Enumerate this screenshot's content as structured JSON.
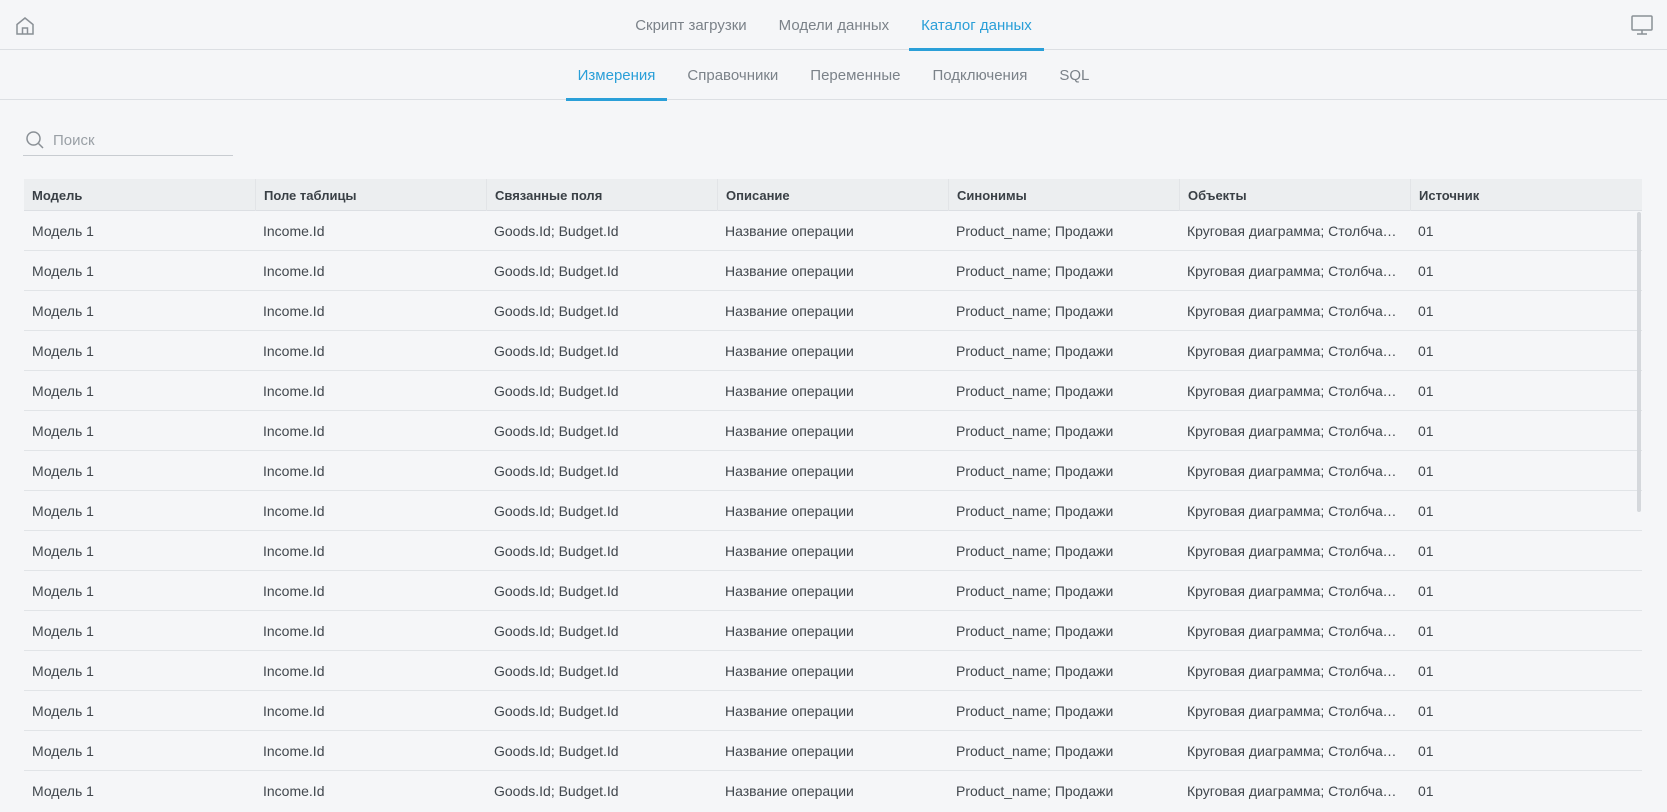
{
  "top_nav": {
    "home_icon": "home-icon",
    "monitor_icon": "monitor-icon",
    "tabs": [
      {
        "label": "Скрипт загрузки",
        "active": false
      },
      {
        "label": "Модели данных",
        "active": false
      },
      {
        "label": "Каталог данных",
        "active": true
      }
    ]
  },
  "sub_nav": {
    "tabs": [
      {
        "label": "Измерения",
        "active": true
      },
      {
        "label": "Справочники",
        "active": false
      },
      {
        "label": "Переменные",
        "active": false
      },
      {
        "label": "Подключения",
        "active": false
      },
      {
        "label": "SQL",
        "active": false
      }
    ]
  },
  "search": {
    "placeholder": "Поиск",
    "value": "",
    "icon": "search-icon"
  },
  "colors": {
    "accent": "#2a9fd8",
    "background": "#f5f6f8",
    "header_bg": "#eceef0"
  },
  "table": {
    "columns": [
      "Модель",
      "Поле таблицы",
      "Связанные поля",
      "Описание",
      "Синонимы",
      "Объекты",
      "Источник"
    ],
    "rows": [
      [
        "Модель 1",
        "Income.Id",
        "Goods.Id; Budget.Id",
        "Название операции",
        "Product_name; Продажи",
        "Круговая диаграмма; Столбчатая диаграмма",
        "01"
      ],
      [
        "Модель 1",
        "Income.Id",
        "Goods.Id; Budget.Id",
        "Название операции",
        "Product_name; Продажи",
        "Круговая диаграмма; Столбчатая диаграмма",
        "01"
      ],
      [
        "Модель 1",
        "Income.Id",
        "Goods.Id; Budget.Id",
        "Название операции",
        "Product_name; Продажи",
        "Круговая диаграмма; Столбчатая диаграмма",
        "01"
      ],
      [
        "Модель 1",
        "Income.Id",
        "Goods.Id; Budget.Id",
        "Название операции",
        "Product_name; Продажи",
        "Круговая диаграмма; Столбчатая диаграмма",
        "01"
      ],
      [
        "Модель 1",
        "Income.Id",
        "Goods.Id; Budget.Id",
        "Название операции",
        "Product_name; Продажи",
        "Круговая диаграмма; Столбчатая диаграмма",
        "01"
      ],
      [
        "Модель 1",
        "Income.Id",
        "Goods.Id; Budget.Id",
        "Название операции",
        "Product_name; Продажи",
        "Круговая диаграмма; Столбчатая диаграмма",
        "01"
      ],
      [
        "Модель 1",
        "Income.Id",
        "Goods.Id; Budget.Id",
        "Название операции",
        "Product_name; Продажи",
        "Круговая диаграмма; Столбчатая диаграмма",
        "01"
      ],
      [
        "Модель 1",
        "Income.Id",
        "Goods.Id; Budget.Id",
        "Название операции",
        "Product_name; Продажи",
        "Круговая диаграмма; Столбчатая диаграмма",
        "01"
      ],
      [
        "Модель 1",
        "Income.Id",
        "Goods.Id; Budget.Id",
        "Название операции",
        "Product_name; Продажи",
        "Круговая диаграмма; Столбчатая диаграмма",
        "01"
      ],
      [
        "Модель 1",
        "Income.Id",
        "Goods.Id; Budget.Id",
        "Название операции",
        "Product_name; Продажи",
        "Круговая диаграмма; Столбчатая диаграмма",
        "01"
      ],
      [
        "Модель 1",
        "Income.Id",
        "Goods.Id; Budget.Id",
        "Название операции",
        "Product_name; Продажи",
        "Круговая диаграмма; Столбчатая диаграмма",
        "01"
      ],
      [
        "Модель 1",
        "Income.Id",
        "Goods.Id; Budget.Id",
        "Название операции",
        "Product_name; Продажи",
        "Круговая диаграмма; Столбчатая диаграмма",
        "01"
      ],
      [
        "Модель 1",
        "Income.Id",
        "Goods.Id; Budget.Id",
        "Название операции",
        "Product_name; Продажи",
        "Круговая диаграмма; Столбчатая диаграмма",
        "01"
      ],
      [
        "Модель 1",
        "Income.Id",
        "Goods.Id; Budget.Id",
        "Название операции",
        "Product_name; Продажи",
        "Круговая диаграмма; Столбчатая диаграмма",
        "01"
      ],
      [
        "Модель 1",
        "Income.Id",
        "Goods.Id; Budget.Id",
        "Название операции",
        "Product_name; Продажи",
        "Круговая диаграмма; Столбчатая диаграмма",
        "01"
      ]
    ]
  }
}
